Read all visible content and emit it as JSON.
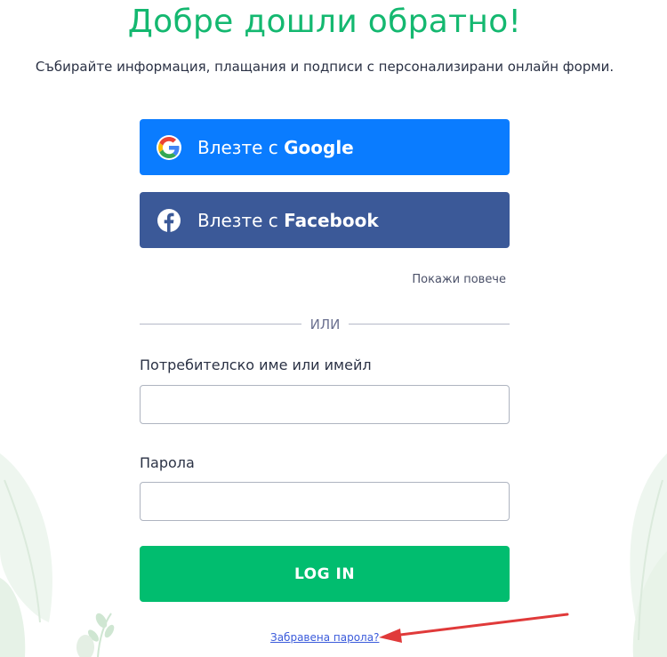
{
  "header": {
    "title": "Добре дошли обратно!",
    "subtitle": "Събирайте информация, плащания и подписи с персонализирани онлайн форми."
  },
  "sso": {
    "google": {
      "prefix": "Влезте с ",
      "brand": "Google",
      "icon": "google-icon",
      "color": "#0a7cff"
    },
    "facebook": {
      "prefix": "Влезте с ",
      "brand": "Facebook",
      "icon": "facebook-icon",
      "color": "#3b5998"
    },
    "show_more": "Покажи повече"
  },
  "divider": {
    "text": "ИЛИ"
  },
  "form": {
    "username_label": "Потребителско име или имейл",
    "username_value": "",
    "username_placeholder": "",
    "password_label": "Парола",
    "password_value": "",
    "password_placeholder": "",
    "login_label": "LOG IN",
    "login_color": "#01bd6f",
    "forgot_password": "Забравена парола?"
  },
  "theme": {
    "accent": "#14b870",
    "annotation_arrow": "#e03a3a"
  }
}
